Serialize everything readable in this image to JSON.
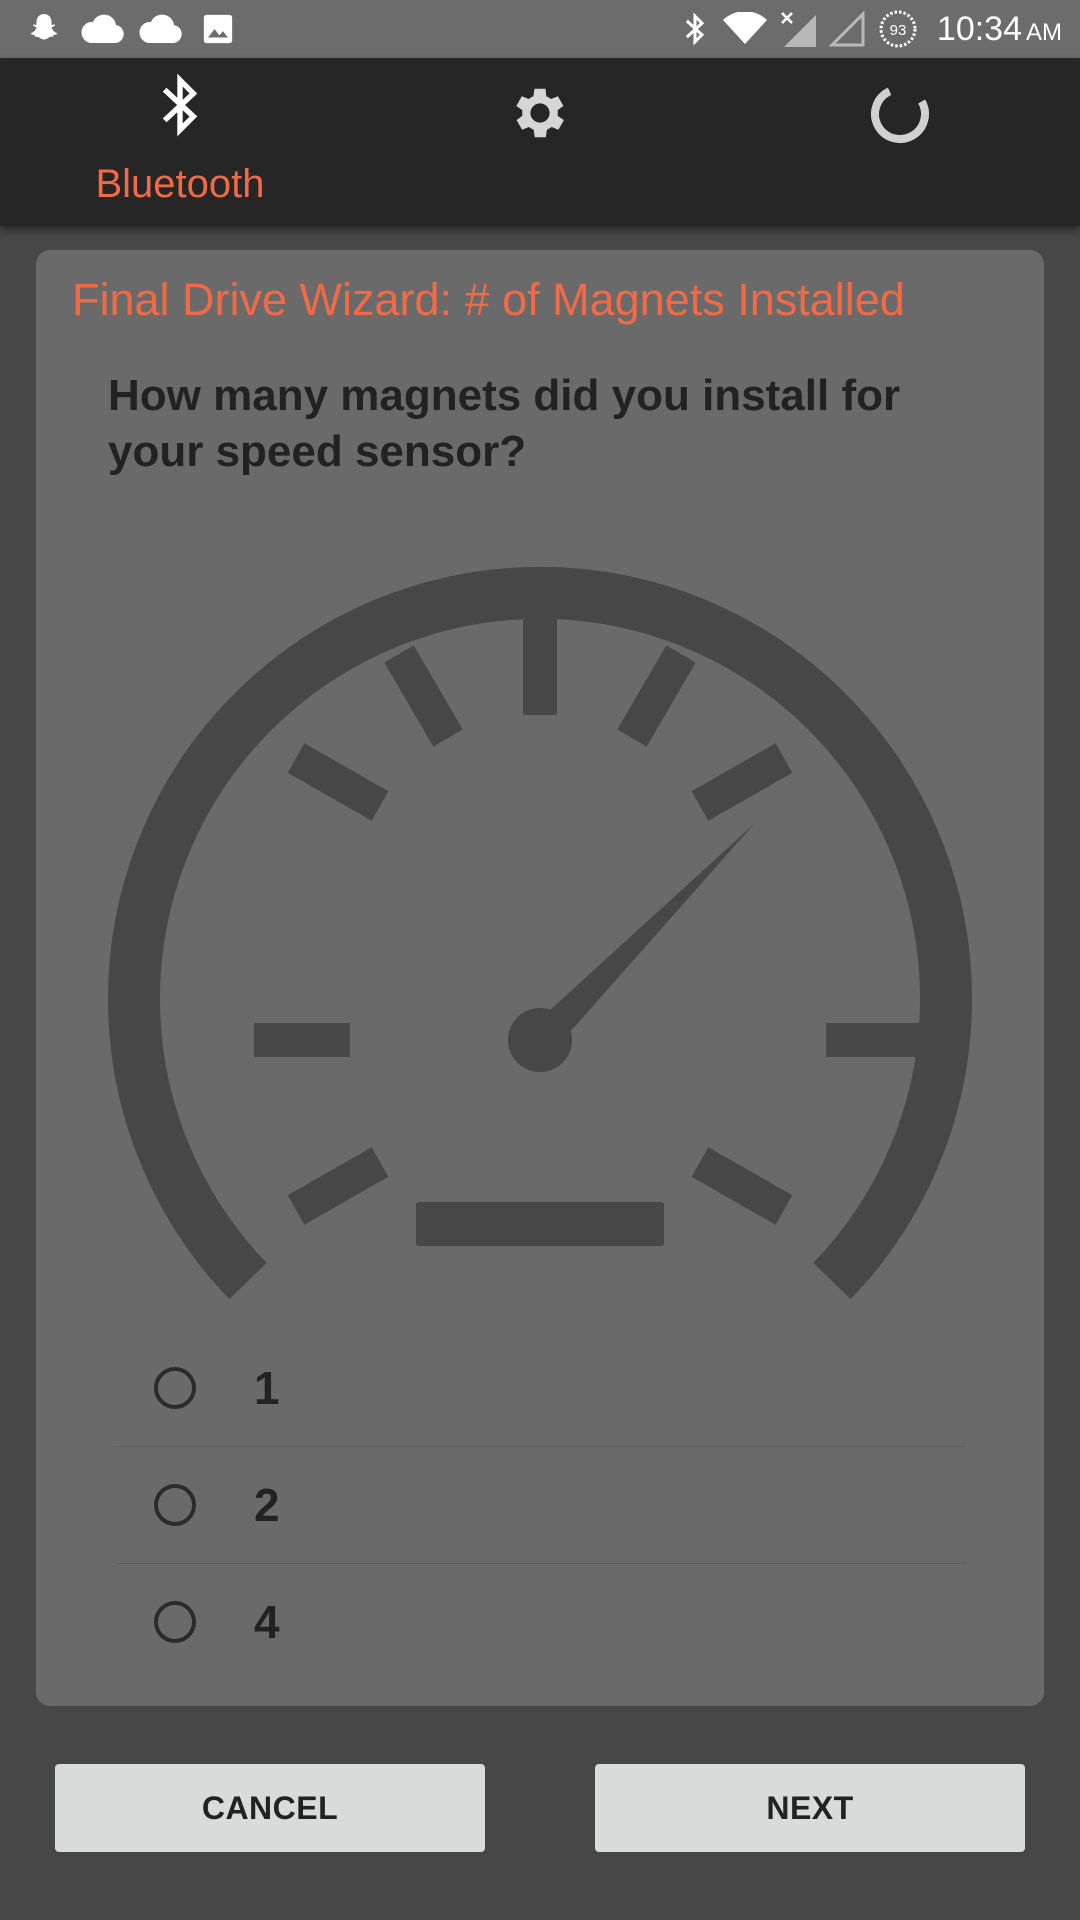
{
  "status_bar": {
    "time": "10:34",
    "ampm": "AM",
    "battery_level": "93",
    "left_icons": [
      "snapchat-icon",
      "cloud-icon",
      "cloud-icon",
      "image-icon"
    ],
    "right_icons": [
      "bluetooth-icon",
      "wifi-icon",
      "signal-x-icon",
      "signal-icon",
      "battery-icon"
    ]
  },
  "nav": {
    "tabs": [
      {
        "name": "bluetooth",
        "label": "Bluetooth",
        "icon": "bluetooth-icon",
        "active": true
      },
      {
        "name": "settings",
        "label": "",
        "icon": "gear-icon",
        "active": false
      },
      {
        "name": "refresh",
        "label": "",
        "icon": "loading-icon",
        "active": false
      }
    ]
  },
  "wizard": {
    "title": "Final Drive Wizard: # of Magnets Installed",
    "question": "How many magnets did you install for your speed sensor?",
    "image_icon": "speedometer-icon",
    "options": [
      {
        "label": "1",
        "selected": false
      },
      {
        "label": "2",
        "selected": false
      },
      {
        "label": "4",
        "selected": false
      }
    ]
  },
  "buttons": {
    "cancel": "CANCEL",
    "next": "NEXT"
  },
  "colors": {
    "accent": "#f26a45",
    "background": "#474747",
    "card": "#6a6a6a",
    "nav": "#262626",
    "button": "#d9dada"
  }
}
